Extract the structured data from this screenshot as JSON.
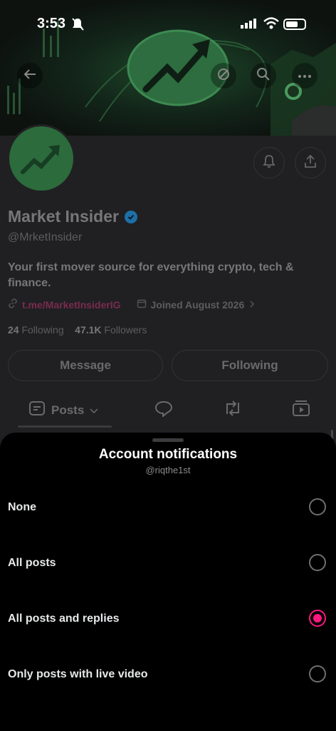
{
  "status_bar": {
    "time": "3:53"
  },
  "profile": {
    "name": "Market Insider",
    "handle": "@MrketInsider",
    "bio": "Your first mover source for everything crypto, tech & finance.",
    "link": "t.me/MarketInsiderIG",
    "joined": "Joined August 2026",
    "following_count": "24",
    "following_label": "Following",
    "followers_count": "47.1K",
    "followers_label": "Followers",
    "message_label": "Message",
    "following_button_label": "Following",
    "tabs": [
      {
        "label": "Posts"
      }
    ]
  },
  "sheet": {
    "title": "Account notifications",
    "subtitle": "@riqthe1st",
    "options": [
      {
        "label": "None",
        "selected": false
      },
      {
        "label": "All posts",
        "selected": false
      },
      {
        "label": "All posts and replies",
        "selected": true
      },
      {
        "label": "Only posts with live video",
        "selected": false
      }
    ],
    "accent_color": "#f9187f"
  },
  "icons": [
    "back-arrow-icon",
    "sync-icon",
    "search-icon",
    "more-icon",
    "notification-bell-icon",
    "share-icon",
    "verified-badge-icon",
    "link-icon",
    "calendar-icon",
    "chevron-right-icon",
    "posts-icon",
    "chevron-down-icon",
    "reply-icon",
    "repost-icon",
    "media-icon"
  ]
}
